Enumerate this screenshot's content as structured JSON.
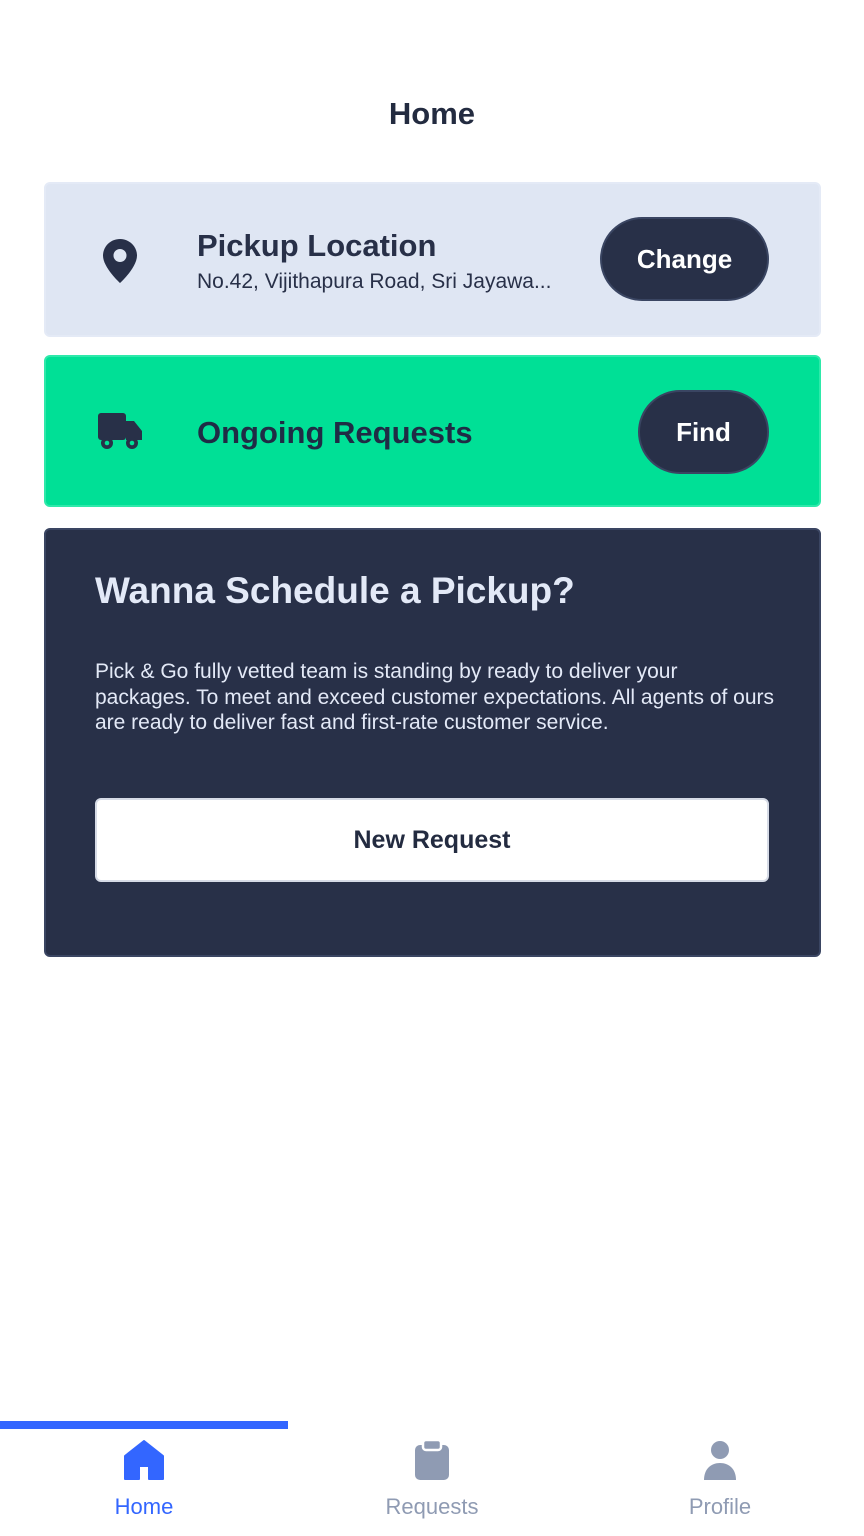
{
  "header": {
    "title": "Home"
  },
  "pickup_location": {
    "title": "Pickup Location",
    "address": "No.42, Vijithapura Road, Sri Jayawa...",
    "change_label": "Change",
    "icon": "map-pin-icon"
  },
  "ongoing": {
    "title": "Ongoing Requests",
    "find_label": "Find",
    "icon": "truck-icon"
  },
  "schedule": {
    "title": "Wanna Schedule a Pickup?",
    "body": "Pick & Go fully vetted team is standing by ready to deliver your packages. To meet and exceed customer expectations. All agents of ours are ready to deliver fast and first-rate customer service.",
    "button_label": "New Request"
  },
  "tabs": [
    {
      "label": "Home",
      "icon": "home-icon",
      "active": true
    },
    {
      "label": "Requests",
      "icon": "clipboard-icon",
      "active": false
    },
    {
      "label": "Profile",
      "icon": "person-icon",
      "active": false
    }
  ],
  "colors": {
    "primary_dark": "#283048",
    "accent_green": "#00e096",
    "location_bg": "#dfe6f3",
    "tab_active": "#3366ff",
    "tab_inactive": "#8f9bb3"
  }
}
